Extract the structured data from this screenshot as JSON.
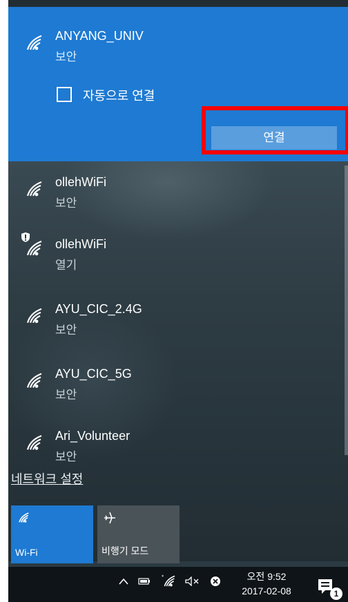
{
  "selected_network": {
    "ssid": "ANYANG_UNIV",
    "status": "보안",
    "auto_connect_label": "자동으로 연결",
    "connect_label": "연결"
  },
  "networks": [
    {
      "ssid": "ollehWiFi",
      "status": "보안",
      "shield": false
    },
    {
      "ssid": "ollehWiFi",
      "status": "열기",
      "shield": true
    },
    {
      "ssid": "AYU_CIC_2.4G",
      "status": "보안",
      "shield": false
    },
    {
      "ssid": "AYU_CIC_5G",
      "status": "보안",
      "shield": false
    },
    {
      "ssid": "Ari_Volunteer",
      "status": "보안",
      "shield": false
    }
  ],
  "network_settings_label": "네트워크 설정",
  "quick_actions": [
    {
      "label": "Wi-Fi",
      "icon": "wifi-icon",
      "active": true
    },
    {
      "label": "비행기 모드",
      "icon": "airplane-icon",
      "active": false
    }
  ],
  "taskbar": {
    "time": "오전 9:52",
    "date": "2017-02-08",
    "notification_count": "1",
    "tray_icons": [
      "chevron-up-icon",
      "battery-icon",
      "wifi-tray-icon",
      "volume-muted-icon",
      "x-circle-icon"
    ]
  },
  "colors": {
    "accent": "#1e7ad2",
    "highlight_box": "#ff0000"
  }
}
